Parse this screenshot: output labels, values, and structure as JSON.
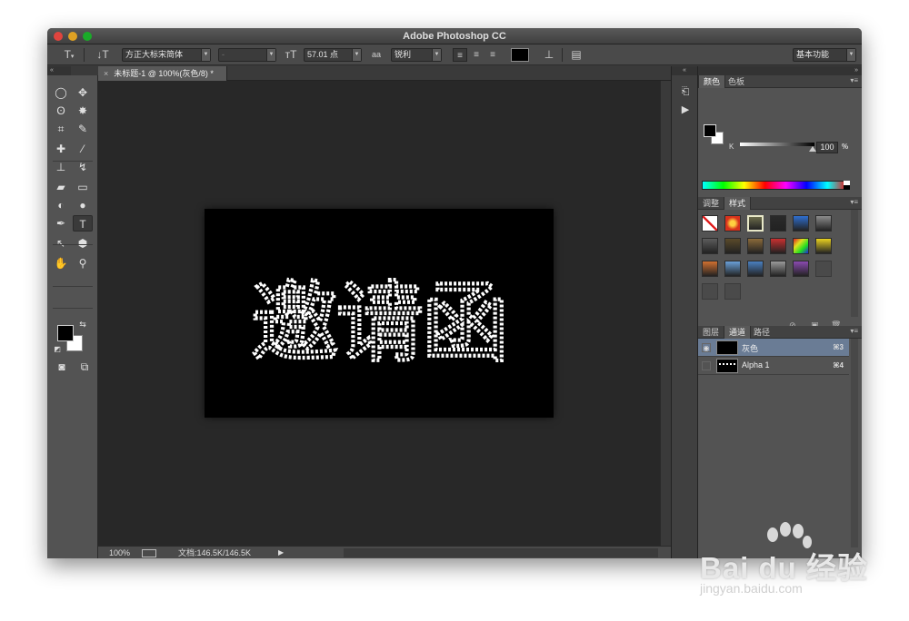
{
  "window": {
    "title": "Adobe Photoshop CC"
  },
  "options_bar": {
    "font_family": "方正大标宋简体",
    "font_style": "-",
    "font_size": "57.01 点",
    "aa_label": "aa",
    "antialias": "锐利",
    "workspace": "基本功能"
  },
  "toolbar": {
    "collapse": "«",
    "tools": [
      {
        "name": "marquee",
        "glyph": "◯"
      },
      {
        "name": "move",
        "glyph": "✥"
      },
      {
        "name": "lasso",
        "glyph": "ʘ"
      },
      {
        "name": "magic-wand",
        "glyph": "✸"
      },
      {
        "name": "crop",
        "glyph": "⌗"
      },
      {
        "name": "eyedropper",
        "glyph": "✎"
      },
      {
        "name": "healing",
        "glyph": "✚"
      },
      {
        "name": "brush",
        "glyph": "⁄"
      },
      {
        "name": "stamp",
        "glyph": "⊥"
      },
      {
        "name": "history-brush",
        "glyph": "↯"
      },
      {
        "name": "eraser",
        "glyph": "▰"
      },
      {
        "name": "gradient",
        "glyph": "▭"
      },
      {
        "name": "blur",
        "glyph": "◐"
      },
      {
        "name": "dodge",
        "glyph": "●"
      },
      {
        "name": "pen",
        "glyph": "✒"
      },
      {
        "name": "type",
        "glyph": "T"
      },
      {
        "name": "path-select",
        "glyph": "↖"
      },
      {
        "name": "shape",
        "glyph": "⬢"
      },
      {
        "name": "hand",
        "glyph": "✋"
      },
      {
        "name": "zoom",
        "glyph": "⚲"
      }
    ]
  },
  "document": {
    "tab_close": "×",
    "tab_title": "未标题-1 @ 100%(灰色/8) *",
    "canvas_text": "邀请函"
  },
  "status": {
    "zoom": "100%",
    "doc_info": "文档:146.5K/146.5K",
    "arrow": "▶"
  },
  "dock": {
    "collapse": "«",
    "expand": "»"
  },
  "color_panel": {
    "tabs": [
      "颜色",
      "色板"
    ],
    "active_tab": 0,
    "channel_label": "K",
    "value": "100",
    "unit": "%",
    "k_fraction": 1.0
  },
  "styles_panel": {
    "tabs": [
      "调整",
      "样式"
    ],
    "active_tab": 1,
    "swatches": [
      {
        "color": "#ffffff",
        "kind": "none"
      },
      {
        "color": "#d8321c",
        "kind": "red-glow"
      },
      {
        "color": "#6b6b4a",
        "kind": "selected"
      },
      {
        "color": "#2a2a2a",
        "kind": "dark"
      },
      {
        "color": "#2f6fd0",
        "kind": "blue"
      },
      {
        "color": "#8c8c8c",
        "kind": "gray"
      },
      {
        "color": "#5c5c5c",
        "kind": "gray-dark"
      },
      {
        "color": "#5a4a2a",
        "kind": "brown"
      },
      {
        "color": "#8a6a3a",
        "kind": "tan"
      },
      {
        "color": "#c83030",
        "kind": "red"
      },
      {
        "color": "#c8c820",
        "kind": "rainbow"
      },
      {
        "color": "#e8d020",
        "kind": "yellow"
      },
      {
        "color": "#d07030",
        "kind": "orange"
      },
      {
        "color": "#6aa0d8",
        "kind": "sky"
      },
      {
        "color": "#4a80c0",
        "kind": "landscape"
      },
      {
        "color": "#9a9a9a",
        "kind": "pattern"
      },
      {
        "color": "#8a4ab0",
        "kind": "purple"
      },
      {
        "color": "#4a4a4a",
        "kind": "empty"
      },
      {
        "color": "#4a4a4a",
        "kind": "empty"
      },
      {
        "color": "#4a4a4a",
        "kind": "empty"
      }
    ]
  },
  "channels_panel": {
    "tabs": [
      "图层",
      "通道",
      "路径"
    ],
    "active_tab": 1,
    "rows": [
      {
        "name": "灰色",
        "shortcut": "⌘3",
        "visible": true,
        "selected": true
      },
      {
        "name": "Alpha 1",
        "shortcut": "⌘4",
        "visible": false,
        "selected": false
      }
    ]
  },
  "watermark": {
    "brand": "Bai du 经验",
    "url": "jingyan.baidu.com"
  }
}
